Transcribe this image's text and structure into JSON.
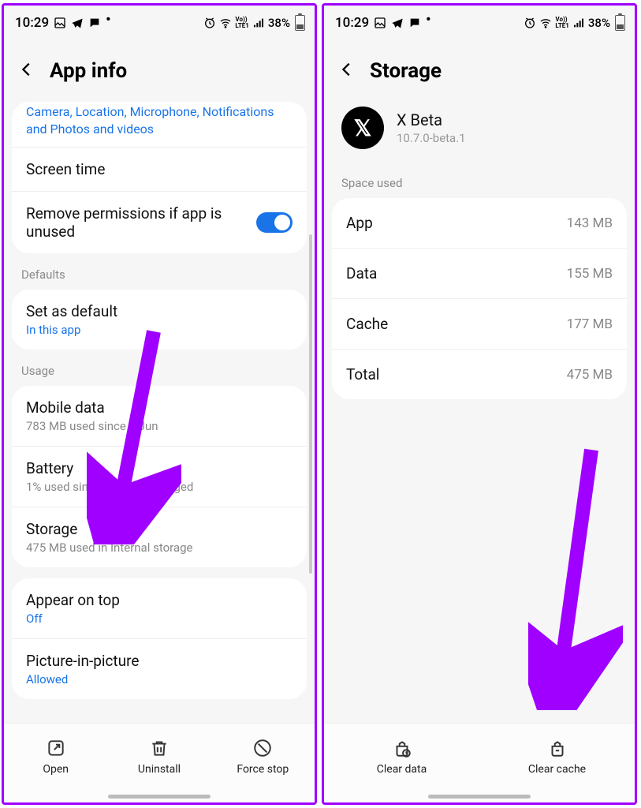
{
  "status": {
    "time": "10:29",
    "battery_pct": "38%"
  },
  "left": {
    "title": "App info",
    "permissions_line": "Camera, Location, Microphone, Notifications and Photos and videos",
    "screen_time": "Screen time",
    "remove_perm": "Remove permissions if app is unused",
    "section_defaults": "Defaults",
    "set_default_title": "Set as default",
    "set_default_sub": "In this app",
    "section_usage": "Usage",
    "mobile_data_title": "Mobile data",
    "mobile_data_sub": "783 MB used since 1 Jun",
    "battery_title": "Battery",
    "battery_sub": "1% used since last fully charged",
    "storage_title": "Storage",
    "storage_sub": "475 MB used in Internal storage",
    "appear_title": "Appear on top",
    "appear_sub": "Off",
    "pip_title": "Picture-in-picture",
    "pip_sub": "Allowed",
    "actions": {
      "open": "Open",
      "uninstall": "Uninstall",
      "force_stop": "Force stop"
    }
  },
  "right": {
    "title": "Storage",
    "app_name": "X Beta",
    "app_version": "10.7.0-beta.1",
    "section_space": "Space used",
    "rows": {
      "app": {
        "k": "App",
        "v": "143 MB"
      },
      "data": {
        "k": "Data",
        "v": "155 MB"
      },
      "cache": {
        "k": "Cache",
        "v": "177 MB"
      },
      "total": {
        "k": "Total",
        "v": "475 MB"
      }
    },
    "actions": {
      "clear_data": "Clear data",
      "clear_cache": "Clear cache"
    }
  }
}
